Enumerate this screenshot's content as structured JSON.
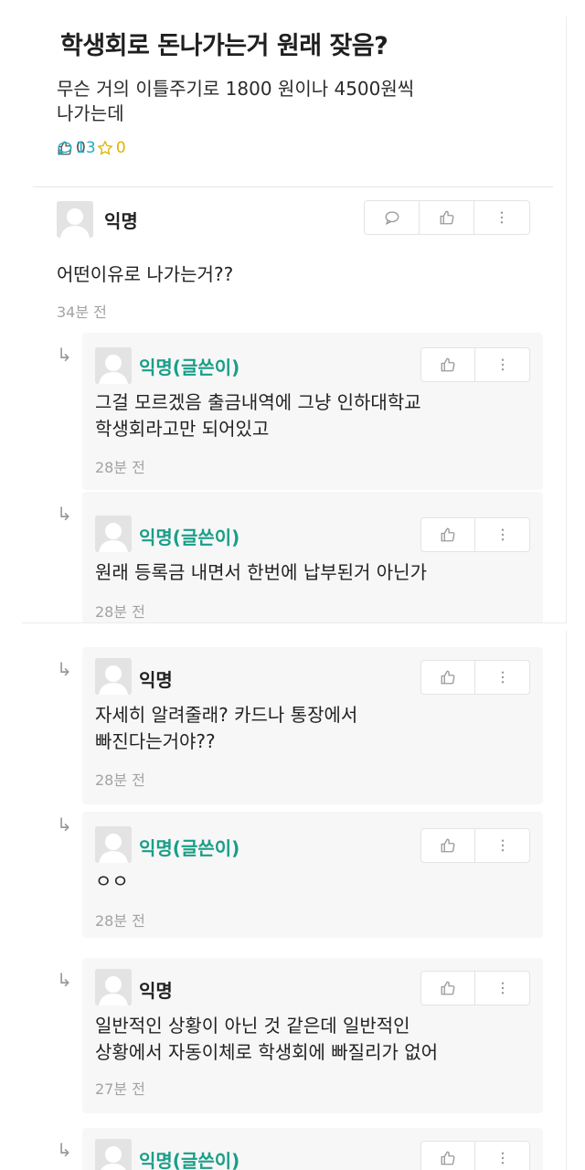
{
  "post": {
    "title": "학생회로 돈나가는거 원래 잦음?",
    "body_line1": "무슨 거의 이틀주기로 1800 원이나 4500원씩",
    "body_line2": "나가는데",
    "likes": "0",
    "comments": "13",
    "scraps": "0"
  },
  "colors": {
    "op_author": "#1a9e88",
    "comment_count": "#1faec4",
    "scrap": "#e0b400"
  },
  "reply_marker": "↳",
  "comments": [
    {
      "author": "익명",
      "text1": "어떤이유로 나가는거??",
      "text2": "",
      "time": "34분 전"
    },
    {
      "author": "익명(글쓴이)",
      "text1": "그걸 모르겠음 출금내역에 그냥 인하대학교",
      "text2": "학생회라고만 되어있고",
      "time": "28분 전"
    },
    {
      "author": "익명(글쓴이)",
      "text1": "원래 등록금 내면서 한번에 납부된거 아닌가",
      "text2": "",
      "time": "28분 전"
    },
    {
      "author": "익명",
      "text1": "자세히 알려줄래? 카드나 통장에서",
      "text2": "빠진다는거야??",
      "time": "28분 전"
    },
    {
      "author": "익명(글쓴이)",
      "text1": "ㅇㅇ",
      "text2": "",
      "time": "28분 전"
    },
    {
      "author": "익명",
      "text1": "일반적인 상황이 아닌 것 같은데 일반적인",
      "text2": "상황에서 자동이체로 학생회에 빠질리가 없어",
      "time": "27분 전"
    },
    {
      "author": "익명(글쓴이)",
      "text1": "",
      "text2": "",
      "time": ""
    }
  ]
}
